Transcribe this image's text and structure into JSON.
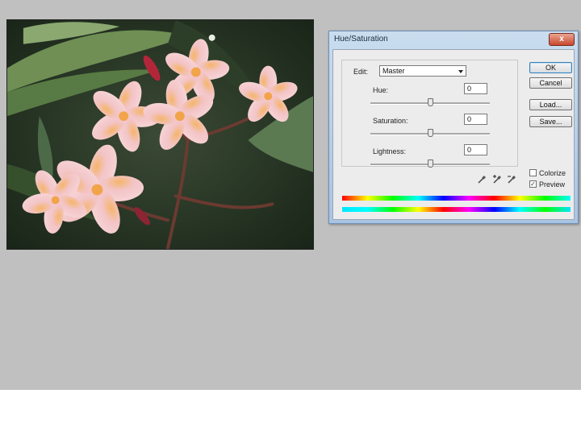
{
  "dialog": {
    "title": "Hue/Saturation",
    "close_label": "x",
    "edit_label": "Edit:",
    "edit_value": "Master",
    "sliders": [
      {
        "label": "Hue:",
        "value": "0",
        "position": 0.5
      },
      {
        "label": "Saturation:",
        "value": "0",
        "position": 0.5
      },
      {
        "label": "Lightness:",
        "value": "0",
        "position": 0.5
      }
    ],
    "buttons": {
      "ok": "OK",
      "cancel": "Cancel",
      "load": "Load...",
      "save": "Save..."
    },
    "colorize": {
      "label": "Colorize",
      "checked": false
    },
    "preview": {
      "label": "Preview",
      "checked": true
    },
    "eyedroppers": [
      "eyedropper-icon",
      "eyedropper-plus-icon",
      "eyedropper-minus-icon"
    ],
    "colors": {
      "titlebar": "#b9d1ea",
      "close": "#c9472d",
      "client": "#ececec"
    }
  },
  "photo": {
    "subject": "plumeria-flowers-image"
  },
  "colors": {
    "workspace": "#c0c0c0",
    "page": "#ffffff"
  }
}
